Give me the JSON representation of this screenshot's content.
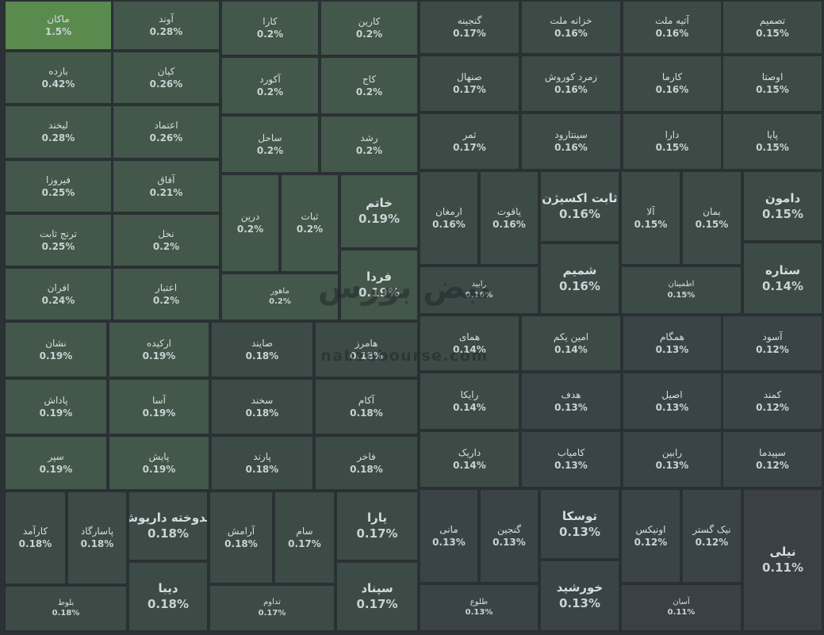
{
  "chart_data": {
    "type": "treemap",
    "unit": "%",
    "colors": {
      "top": "#5a8a4e",
      "high": "#43574a",
      "mid": "#3d4b46",
      "low": "#3a4446",
      "lowest": "#3a4046",
      "border": "#2a3034"
    },
    "items": [
      {
        "name": "ماکان",
        "value": "1.5%"
      },
      {
        "name": "آوند",
        "value": "0.28%"
      },
      {
        "name": "کارا",
        "value": "0.2%"
      },
      {
        "name": "کارین",
        "value": "0.2%"
      },
      {
        "name": "گنجینه",
        "value": "0.17%"
      },
      {
        "name": "خزانه ملت",
        "value": "0.16%"
      },
      {
        "name": "آتیه ملت",
        "value": "0.16%"
      },
      {
        "name": "تصمیم",
        "value": "0.15%"
      },
      {
        "name": "بازده",
        "value": "0.42%"
      },
      {
        "name": "کیان",
        "value": "0.26%"
      },
      {
        "name": "آکورد",
        "value": "0.2%"
      },
      {
        "name": "کاج",
        "value": "0.2%"
      },
      {
        "name": "صنهال",
        "value": "0.17%"
      },
      {
        "name": "زمرد کوروش",
        "value": "0.16%"
      },
      {
        "name": "کارما",
        "value": "0.16%"
      },
      {
        "name": "اوصتا",
        "value": "0.15%"
      },
      {
        "name": "لیخند",
        "value": "0.28%"
      },
      {
        "name": "اعتماد",
        "value": "0.26%"
      },
      {
        "name": "ساحل",
        "value": "0.2%"
      },
      {
        "name": "رشد",
        "value": "0.2%"
      },
      {
        "name": "ثمر",
        "value": "0.17%"
      },
      {
        "name": "سپنتارود",
        "value": "0.16%"
      },
      {
        "name": "دارا",
        "value": "0.15%"
      },
      {
        "name": "پایا",
        "value": "0.15%"
      },
      {
        "name": "فیروزا",
        "value": "0.25%"
      },
      {
        "name": "آفاق",
        "value": "0.21%"
      },
      {
        "name": "درین",
        "value": "0.2%"
      },
      {
        "name": "ثبات",
        "value": "0.2%"
      },
      {
        "name": "خاتم",
        "value": "0.19%"
      },
      {
        "name": "ارمغان",
        "value": "0.16%"
      },
      {
        "name": "یاقوت",
        "value": "0.16%"
      },
      {
        "name": "ثابت اکسیژن",
        "value": "0.16%"
      },
      {
        "name": "آلا",
        "value": "0.15%"
      },
      {
        "name": "بمان",
        "value": "0.15%"
      },
      {
        "name": "دامون",
        "value": "0.15%"
      },
      {
        "name": "ترنج ثابت",
        "value": "0.25%"
      },
      {
        "name": "نخل",
        "value": "0.2%"
      },
      {
        "name": "شمیم",
        "value": "0.16%"
      },
      {
        "name": "ستاره",
        "value": "0.14%"
      },
      {
        "name": "افران",
        "value": "0.24%"
      },
      {
        "name": "اعتبار",
        "value": "0.2%"
      },
      {
        "name": "ماهور",
        "value": "0.2%"
      },
      {
        "name": "فردا",
        "value": "0.19%"
      },
      {
        "name": "رابید",
        "value": "0.16%"
      },
      {
        "name": "اطمینان",
        "value": "0.15%"
      },
      {
        "name": "نشان",
        "value": "0.19%"
      },
      {
        "name": "ارکیده",
        "value": "0.19%"
      },
      {
        "name": "صایند",
        "value": "0.18%"
      },
      {
        "name": "هامرز",
        "value": "0.18%"
      },
      {
        "name": "همای",
        "value": "0.14%"
      },
      {
        "name": "امین یکم",
        "value": "0.14%"
      },
      {
        "name": "همگام",
        "value": "0.13%"
      },
      {
        "name": "آسود",
        "value": "0.12%"
      },
      {
        "name": "پاداش",
        "value": "0.19%"
      },
      {
        "name": "آسا",
        "value": "0.19%"
      },
      {
        "name": "سخند",
        "value": "0.18%"
      },
      {
        "name": "آکام",
        "value": "0.18%"
      },
      {
        "name": "رایکا",
        "value": "0.14%"
      },
      {
        "name": "هدف",
        "value": "0.13%"
      },
      {
        "name": "اصیل",
        "value": "0.13%"
      },
      {
        "name": "کمند",
        "value": "0.12%"
      },
      {
        "name": "سپر",
        "value": "0.19%"
      },
      {
        "name": "پایش",
        "value": "0.19%"
      },
      {
        "name": "پارند",
        "value": "0.18%"
      },
      {
        "name": "فاخر",
        "value": "0.18%"
      },
      {
        "name": "داریک",
        "value": "0.14%"
      },
      {
        "name": "کامیاب",
        "value": "0.13%"
      },
      {
        "name": "رابین",
        "value": "0.13%"
      },
      {
        "name": "سپیدما",
        "value": "0.12%"
      },
      {
        "name": "کارآمد",
        "value": "0.18%"
      },
      {
        "name": "پاسارگاد",
        "value": "0.18%"
      },
      {
        "name": "اندوخته داریوش",
        "value": "0.18%"
      },
      {
        "name": "آرامش",
        "value": "0.18%"
      },
      {
        "name": "سام",
        "value": "0.17%"
      },
      {
        "name": "یارا",
        "value": "0.17%"
      },
      {
        "name": "مانی",
        "value": "0.13%"
      },
      {
        "name": "گنجین",
        "value": "0.13%"
      },
      {
        "name": "توسکا",
        "value": "0.13%"
      },
      {
        "name": "اونیکس",
        "value": "0.12%"
      },
      {
        "name": "نیک گستر",
        "value": "0.12%"
      },
      {
        "name": "نیلی",
        "value": "0.11%"
      },
      {
        "name": "بلوط",
        "value": "0.18%"
      },
      {
        "name": "دیبا",
        "value": "0.18%"
      },
      {
        "name": "تداوم",
        "value": "0.17%"
      },
      {
        "name": "سپناد",
        "value": "0.17%"
      },
      {
        "name": "طلوع",
        "value": "0.13%"
      },
      {
        "name": "خورشید",
        "value": "0.13%"
      },
      {
        "name": "آسان",
        "value": "0.11%"
      }
    ]
  },
  "watermark": {
    "text": "نبض بورس",
    "url": "nabzebourse.com"
  }
}
